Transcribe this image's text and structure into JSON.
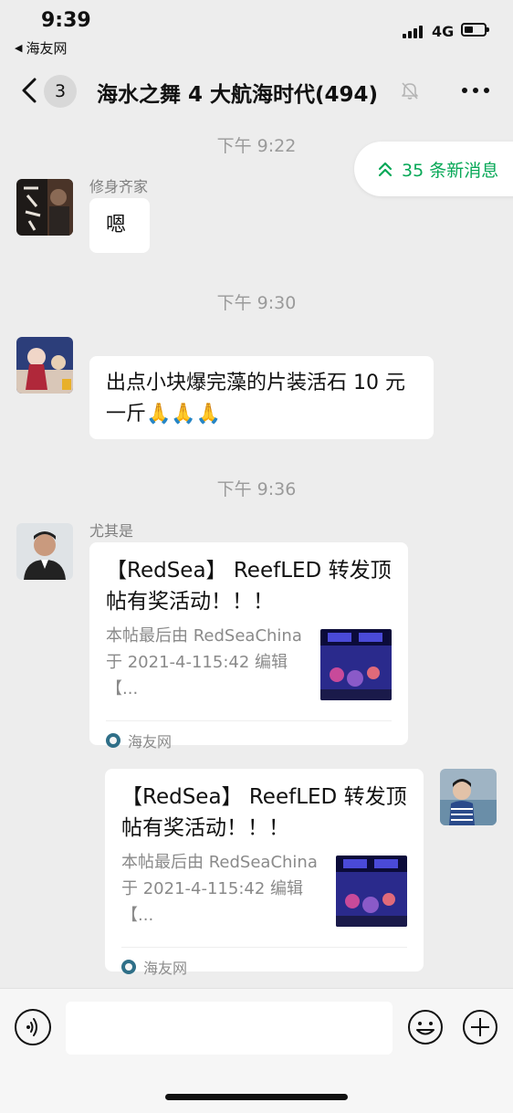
{
  "status_bar": {
    "time": "9:39",
    "back_app": "海友网",
    "network": "4G"
  },
  "nav": {
    "badge_count": "3",
    "title": "海水之舞 4 大航海时代(494)"
  },
  "new_messages": {
    "label": "35 条新消息"
  },
  "messages": [
    {
      "type": "time",
      "text": "下午 9:22"
    },
    {
      "type": "text",
      "sender": "修身齐家",
      "text": "嗯"
    },
    {
      "type": "time",
      "text": "下午 9:30"
    },
    {
      "type": "text",
      "sender": "",
      "text": "出点小块爆完藻的片装活石 10 元一斤🙏🙏🙏"
    },
    {
      "type": "time",
      "text": "下午 9:36"
    },
    {
      "type": "link_card",
      "sender": "尤其是",
      "title": "【RedSea】 ReefLED 转发顶帖有奖活动！！！",
      "description": "本帖最后由 RedSeaChina 于 2021-4-115:42 编辑【...",
      "source": "海友网"
    },
    {
      "type": "link_card",
      "sender": "",
      "self": true,
      "title": "【RedSea】 ReefLED 转发顶帖有奖活动！！！",
      "description": "本帖最后由 RedSeaChina 于 2021-4-115:42 编辑【...",
      "source": "海友网"
    }
  ],
  "input": {
    "value": "",
    "placeholder": ""
  },
  "icons": {
    "back": "chevron-left-icon",
    "mute": "bell-slash-icon",
    "more": "more-icon",
    "new_messages": "double-chevron-up-icon",
    "voice": "voice-icon",
    "emoji": "emoji-icon",
    "plus": "plus-icon"
  },
  "colors": {
    "background": "#ededed",
    "accent_green": "#07a857",
    "bubble": "#ffffff",
    "timestamp": "#9a9a9a"
  }
}
